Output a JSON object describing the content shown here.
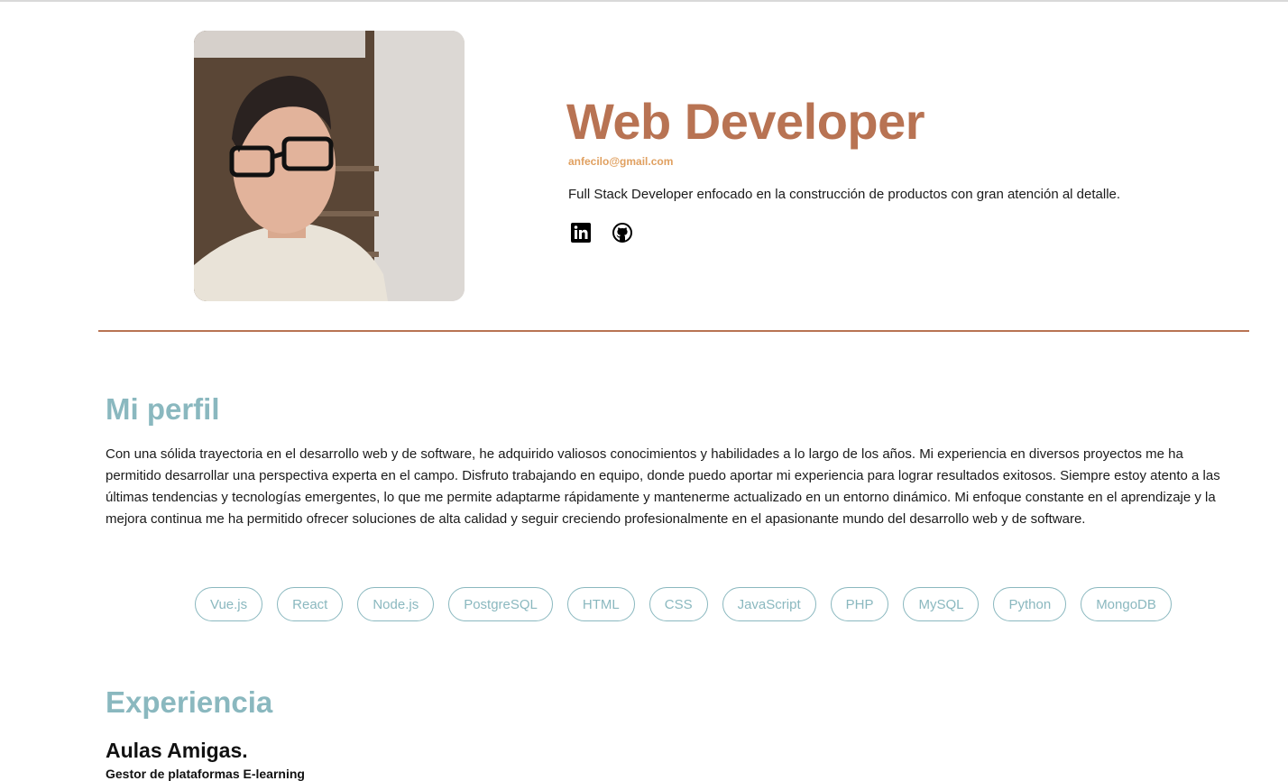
{
  "hero": {
    "title": "Web Developer",
    "email": "anfecilo@gmail.com",
    "tagline": "Full Stack Developer enfocado en la construcción de productos con gran atención al detalle.",
    "social": [
      {
        "icon": "linkedin-icon"
      },
      {
        "icon": "github-icon"
      }
    ],
    "photo_icon": "profile-photo"
  },
  "profile": {
    "title": "Mi perfil",
    "text": "Con una sólida trayectoria en el desarrollo web y de software, he adquirido valiosos conocimientos y habilidades a lo largo de los años. Mi experiencia en diversos proyectos me ha permitido desarrollar una perspectiva experta en el campo. Disfruto trabajando en equipo, donde puedo aportar mi experiencia para lograr resultados exitosos. Siempre estoy atento a las últimas tendencias y tecnologías emergentes, lo que me permite adaptarme rápidamente y mantenerme actualizado en un entorno dinámico. Mi enfoque constante en el aprendizaje y la mejora continua me ha permitido ofrecer soluciones de alta calidad y seguir creciendo profesionalmente en el apasionante mundo del desarrollo web y de software."
  },
  "skills": [
    "Vue.js",
    "React",
    "Node.js",
    "PostgreSQL",
    "HTML",
    "CSS",
    "JavaScript",
    "PHP",
    "MySQL",
    "Python",
    "MongoDB"
  ],
  "experience": {
    "title": "Experiencia",
    "jobs": [
      {
        "company": "Aulas Amigas.",
        "role": "Gestor de plataformas E-learning"
      }
    ]
  },
  "colors": {
    "accent": "#b87353",
    "email": "#e0a060",
    "section": "#8ab8bf"
  }
}
